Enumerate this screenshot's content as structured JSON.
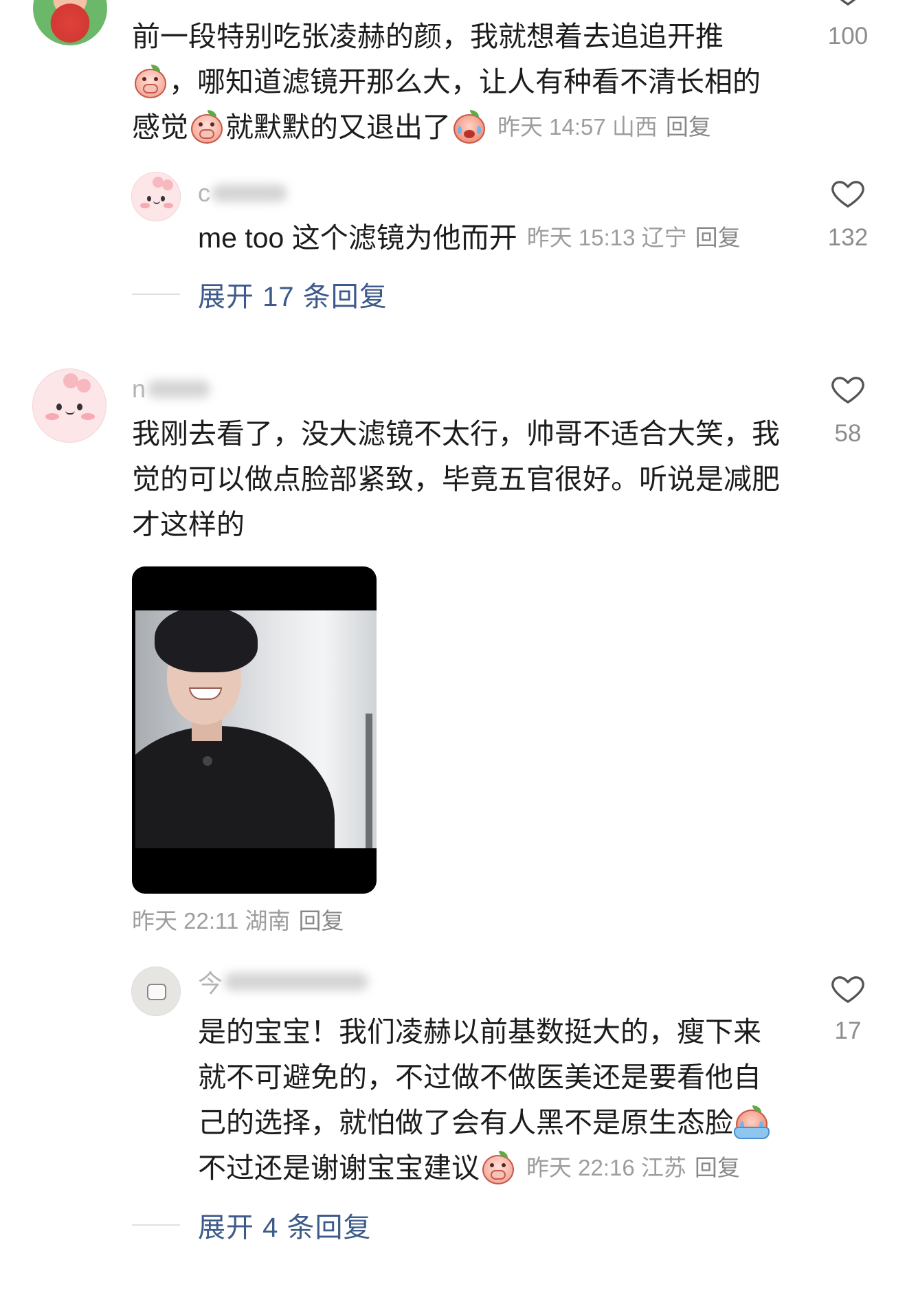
{
  "colors": {
    "text": "#1c1c1c",
    "meta": "#9d9d9d",
    "reply": "#888888",
    "link": "#3d5a8a",
    "count": "#8c8c8c"
  },
  "comment_top": {
    "like_count": "100",
    "line1": "前一段特别吃张凌赫的颜，我就想着去追追开推",
    "line2": "，哪知道滤镜开那么大，让人有种看不清长相的",
    "line3a": "感觉",
    "line3b": "就默默的又退出了",
    "meta": "昨天 14:57 山西",
    "reply_label": "回复",
    "emojis": [
      "peach-cover-mouth-icon",
      "peach-cover-mouth-icon",
      "peach-crying-icon"
    ]
  },
  "reply_1": {
    "username_initial": "c",
    "text": "me too 这个滤镜为他而开",
    "meta": "昨天 15:13 辽宁",
    "reply_label": "回复",
    "like_count": "132"
  },
  "expand_1": {
    "label": "展开 17 条回复"
  },
  "comment_2": {
    "username_initial": "n",
    "lines": [
      "我刚去看了，没大滤镜不太行，帅哥不适合大笑，我",
      "觉的可以做点脸部紧致，毕竟五官很好。听说是减肥",
      "才这样的"
    ],
    "meta": "昨天 22:11 湖南",
    "reply_label": "回复",
    "like_count": "58"
  },
  "reply_2": {
    "username_initial": "今",
    "lines": [
      "是的宝宝！我们凌赫以前基数挺大的，瘦下来",
      "就不可避免的，不过做不做医美还是要看他自",
      "己的选择，就怕做了会有人黑不是原生态脸",
      "不过还是谢谢宝宝建议"
    ],
    "meta": "昨天 22:16 江苏",
    "reply_label": "回复",
    "like_count": "17",
    "emojis": [
      "peach-crying-tub-icon",
      "peach-cover-mouth-icon"
    ]
  },
  "expand_2": {
    "label": "展开 4 条回复"
  }
}
